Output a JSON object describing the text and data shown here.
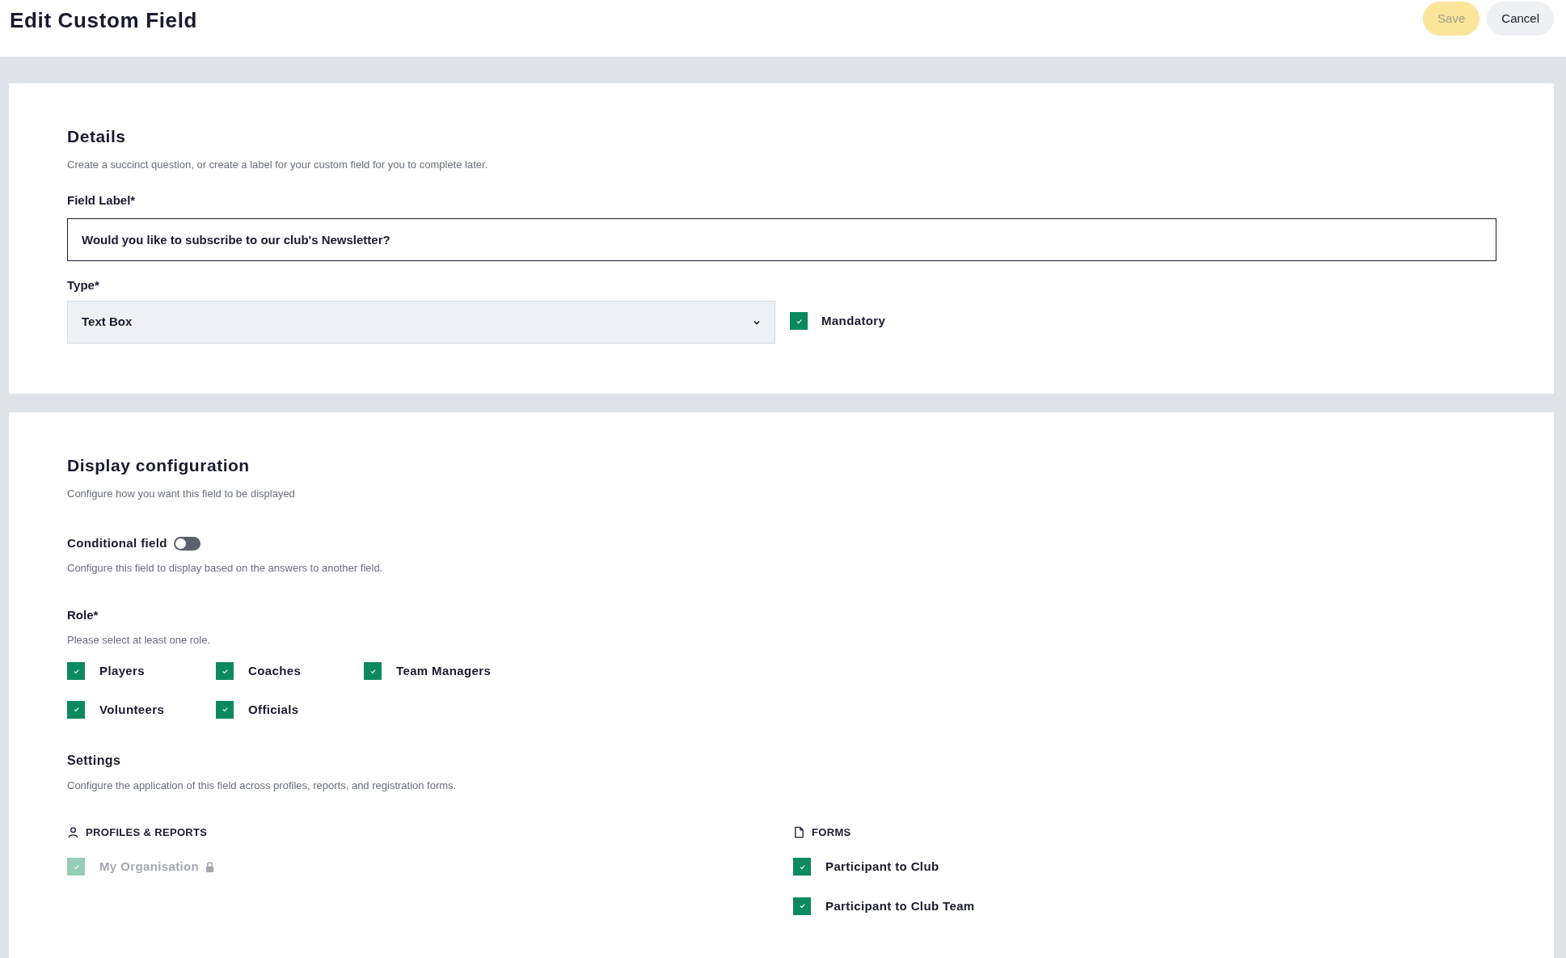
{
  "page_title": "Edit Custom Field",
  "buttons": [
    {
      "label": "Save",
      "kind": "primary",
      "disabled": true
    },
    {
      "label": "Cancel",
      "kind": "secondary",
      "disabled": false
    }
  ],
  "details": {
    "title": "Details",
    "description": "Create a succinct question, or create a label for your custom field for you to complete later.",
    "field_label": {
      "label": "Field Label*",
      "value": "Would you like to subscribe to our club's Newsletter?"
    },
    "type": {
      "label": "Type*",
      "value": "Text Box"
    },
    "mandatory": {
      "label": "Mandatory",
      "checked": true
    }
  },
  "display": {
    "title": "Display configuration",
    "description": "Configure how you want this field to be displayed",
    "conditional": {
      "label": "Conditional field",
      "on": false,
      "description": "Configure this field to display based on the answers to another field."
    },
    "role": {
      "label": "Role*",
      "description": "Please select at least one role.",
      "options": [
        {
          "label": "Players",
          "checked": true
        },
        {
          "label": "Coaches",
          "checked": true
        },
        {
          "label": "Team Managers",
          "checked": true
        },
        {
          "label": "Volunteers",
          "checked": true
        },
        {
          "label": "Officials",
          "checked": true
        }
      ]
    },
    "settings": {
      "title": "Settings",
      "description": "Configure the application of this field across profiles, reports, and registration forms.",
      "groups": [
        {
          "kind": "profiles",
          "title": "PROFILES & REPORTS",
          "items": [
            {
              "label": "My Organisation",
              "checked": true,
              "disabled": true,
              "locked": true
            }
          ]
        },
        {
          "kind": "forms",
          "title": "FORMS",
          "items": [
            {
              "label": "Participant to Club",
              "checked": true,
              "disabled": false,
              "locked": false
            },
            {
              "label": "Participant to Club Team",
              "checked": true,
              "disabled": false,
              "locked": false
            }
          ]
        }
      ]
    }
  }
}
